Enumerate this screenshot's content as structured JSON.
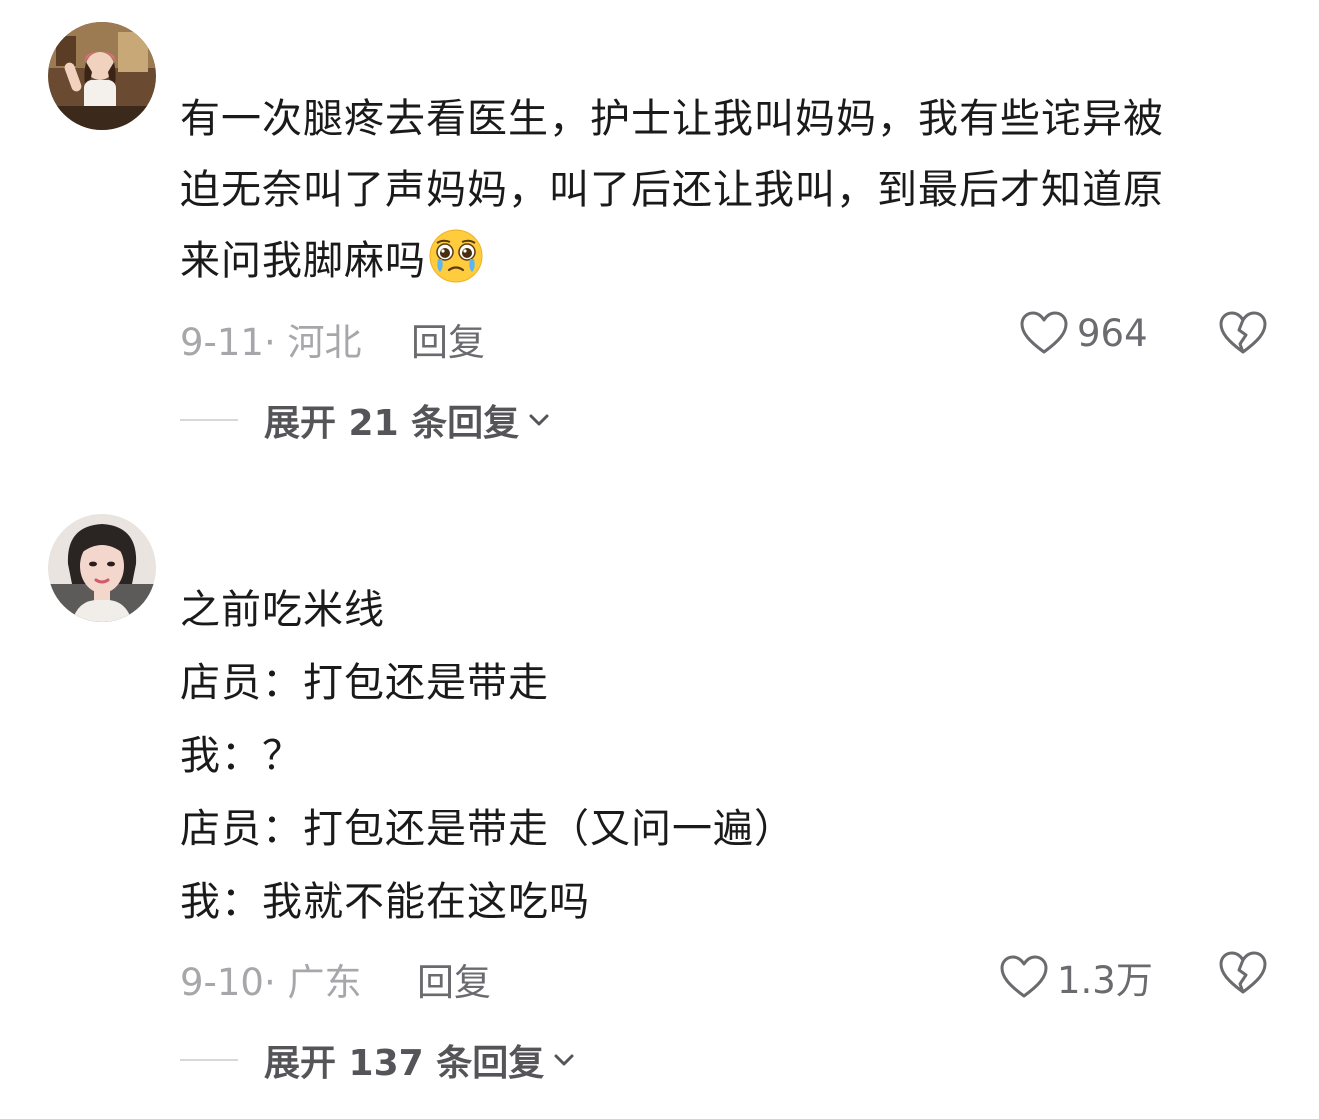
{
  "comments": [
    {
      "avatar": "user-avatar",
      "lines": [
        "有一次腿疼去看医生，护士让我叫妈妈，我有些诧异被",
        "迫无奈叫了声妈妈，叫了后还让我叫，到最后才知道原",
        "来问我脚麻吗"
      ],
      "emoji": "pleading-crying-face-emoji",
      "date": "9-11",
      "location": "河北",
      "meta_sep": "·",
      "reply_label": "回复",
      "like_count": "964",
      "like_icon": "heart-icon",
      "dislike_icon": "broken-heart-icon",
      "expand_label": "展开 21 条回复"
    },
    {
      "avatar": "user-avatar",
      "lines": [
        "之前吃米线",
        "店员：打包还是带走",
        "我：？",
        "店员：打包还是带走（又问一遍）",
        "我：我就不能在这吃吗"
      ],
      "date": "9-10",
      "location": "广东",
      "meta_sep": "·",
      "reply_label": "回复",
      "like_count": "1.3万",
      "like_icon": "heart-icon",
      "dislike_icon": "broken-heart-icon",
      "expand_label": "展开 137 条回复"
    }
  ],
  "colors": {
    "text": "#1a1a1a",
    "meta": "#a7a7ab",
    "action": "#6b6b6f"
  }
}
